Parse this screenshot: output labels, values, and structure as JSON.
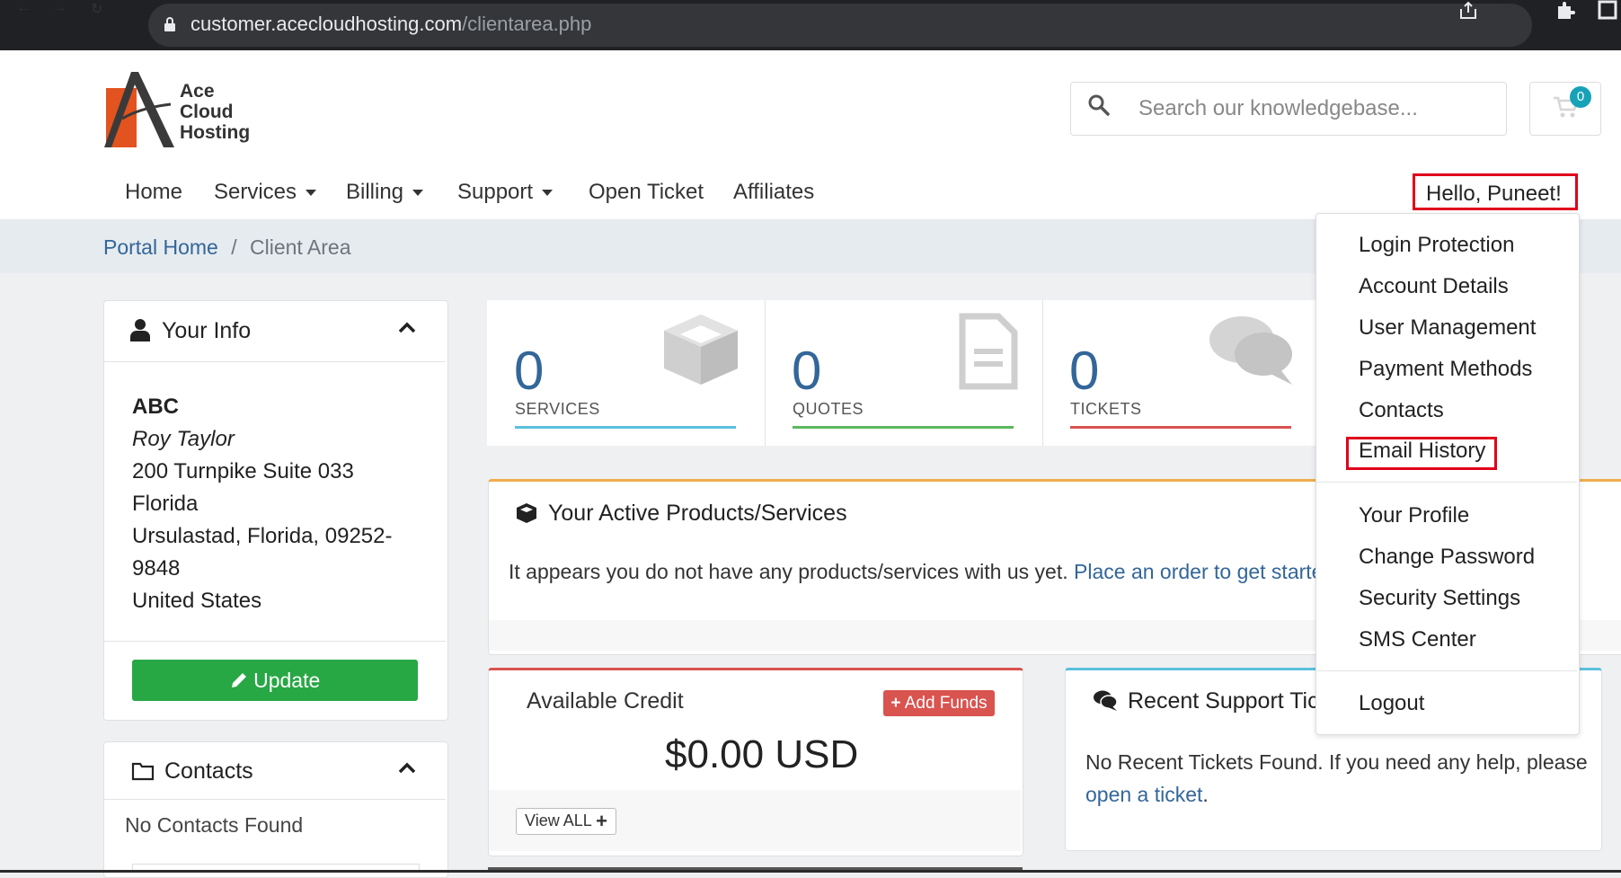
{
  "browser": {
    "url_host": "customer.acecloudhosting.com",
    "url_path": "/clientarea.php",
    "icons": [
      "back-arrow-icon",
      "forward-arrow-icon",
      "reload-icon",
      "lock-icon",
      "share-icon",
      "star-icon",
      "extensions-icon",
      "window-icon"
    ]
  },
  "logo": {
    "line1": "Ace",
    "line2": "Cloud",
    "line3": "Hosting"
  },
  "search": {
    "placeholder": "Search our knowledgebase..."
  },
  "cart": {
    "count": "0"
  },
  "nav": {
    "home": "Home",
    "services": "Services",
    "billing": "Billing",
    "support": "Support",
    "open_ticket": "Open Ticket",
    "affiliates": "Affiliates",
    "user": "Hello, Puneet!"
  },
  "breadcrumb": {
    "home": "Portal Home",
    "sep": "/",
    "current": "Client Area"
  },
  "your_info": {
    "title": "Your Info",
    "company": "ABC",
    "name": "Roy Taylor",
    "address1": "200 Turnpike Suite 033",
    "address2": "Florida",
    "city_line1": "Ursulastad, Florida, 09252-",
    "city_line2": "9848",
    "country": "United States",
    "update_label": "Update"
  },
  "contacts": {
    "title": "Contacts",
    "empty": "No Contacts Found"
  },
  "tiles": [
    {
      "count": "0",
      "label": "SERVICES",
      "color": "#5bc0de"
    },
    {
      "count": "0",
      "label": "QUOTES",
      "color": "#5cb85c"
    },
    {
      "count": "0",
      "label": "TICKETS",
      "color": "#d9534f"
    }
  ],
  "products": {
    "title": "Your Active Products/Services",
    "text": "It appears you do not have any products/services with us yet.",
    "link": "Place an order to get started"
  },
  "credit": {
    "title": "Available Credit",
    "add_funds": "Add Funds",
    "amount": "$0.00 USD",
    "view_all": "View ALL"
  },
  "tickets": {
    "title": "Recent Support Tickets",
    "text": "No Recent Tickets Found. If you need any help, please",
    "link": "open a ticket",
    "end": "."
  },
  "user_dropdown": {
    "items": [
      "Login Protection",
      "Account Details",
      "User Management",
      "Payment Methods",
      "Contacts",
      "Email History"
    ],
    "items2": [
      "Your Profile",
      "Change Password",
      "Security Settings",
      "SMS Center"
    ],
    "logout": "Logout"
  },
  "colors": {
    "brand_link": "#336699",
    "highlight": "#e0001b",
    "update_green": "#28a745",
    "danger": "#d9534f"
  }
}
